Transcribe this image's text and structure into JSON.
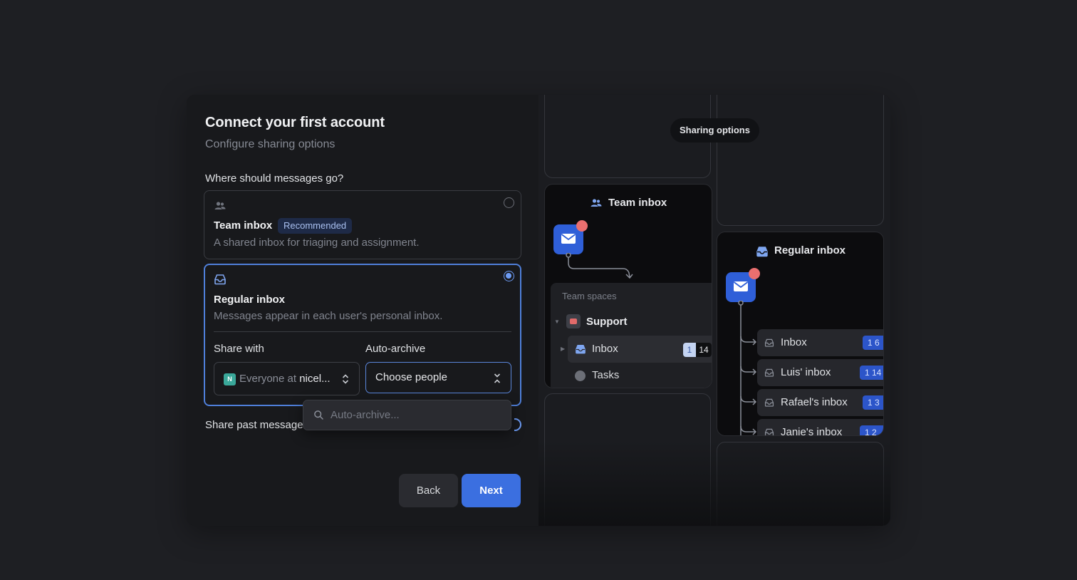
{
  "dialog": {
    "title": "Connect your first account",
    "subtitle": "Configure sharing options",
    "question": "Where should messages go?"
  },
  "options": {
    "team": {
      "title": "Team inbox",
      "badge": "Recommended",
      "description": "A shared inbox for triaging and assignment.",
      "selected": false,
      "icon": "users-icon"
    },
    "regular": {
      "title": "Regular inbox",
      "description": "Messages appear in each user's personal inbox.",
      "selected": true,
      "icon": "inbox-icon"
    }
  },
  "share_with": {
    "label": "Share with",
    "org_icon_letter": "N",
    "value_prefix": "Everyone at ",
    "value_org": "nicel..."
  },
  "auto_archive": {
    "label": "Auto-archive",
    "value": "Choose people",
    "search_placeholder": "Auto-archive..."
  },
  "share_past": {
    "label": "Share past message"
  },
  "buttons": {
    "back": "Back",
    "next": "Next"
  },
  "illustration": {
    "pill": "Sharing options",
    "team_panel": {
      "title": "Team inbox",
      "spaces_label": "Team spaces",
      "space_name": "Support",
      "inbox_label": "Inbox",
      "inbox_count_unread": "1",
      "inbox_count_total": "14",
      "tasks_label": "Tasks"
    },
    "regular_panel": {
      "title": "Regular inbox",
      "rows": [
        {
          "label": "Inbox",
          "count": "1 6"
        },
        {
          "label": "Luis' inbox",
          "count": "1 14"
        },
        {
          "label": "Rafael's inbox",
          "count": "1 3"
        },
        {
          "label": "Janie's inbox",
          "count": "1 2"
        }
      ]
    }
  },
  "colors": {
    "accent": "#3b6fe0",
    "selected_border": "#4f7fd9",
    "badge_bg": "#1e2a47",
    "notification": "#ea6f6f"
  }
}
